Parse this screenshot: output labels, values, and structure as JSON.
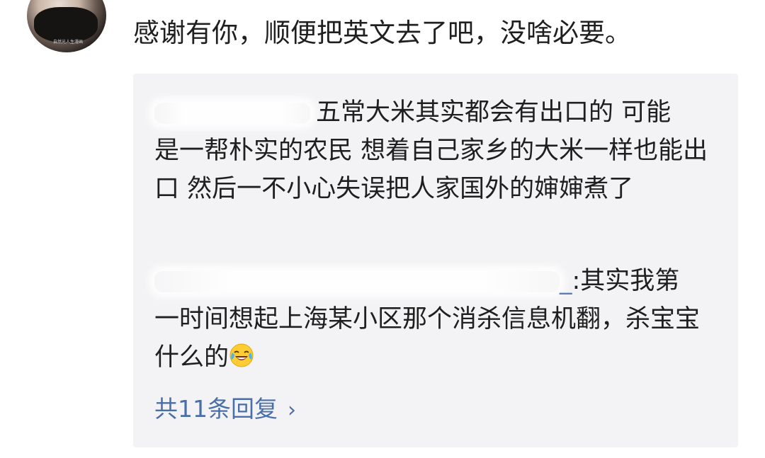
{
  "comment": {
    "text": "感谢有你，顺便把英文去了吧，没啥必要。"
  },
  "avatar": {
    "caption": "自然光人生漫画"
  },
  "replies": [
    {
      "text_line1": "五常大米其实都会有出口的 可能",
      "text_rest": "是一帮朴实的农民 想着自己家乡的大米一样也能出口 然后一不小心失误把人家国外的婶婶煮了"
    },
    {
      "name_tail": "_",
      "text_line1": ":其实我第",
      "text_rest": "一时间想起上海某小区那个消杀信息机翻，杀宝宝什么的",
      "emoji": "laughing-crying-emoji"
    }
  ],
  "more_replies": {
    "label": "共11条回复",
    "chevron": "›"
  }
}
